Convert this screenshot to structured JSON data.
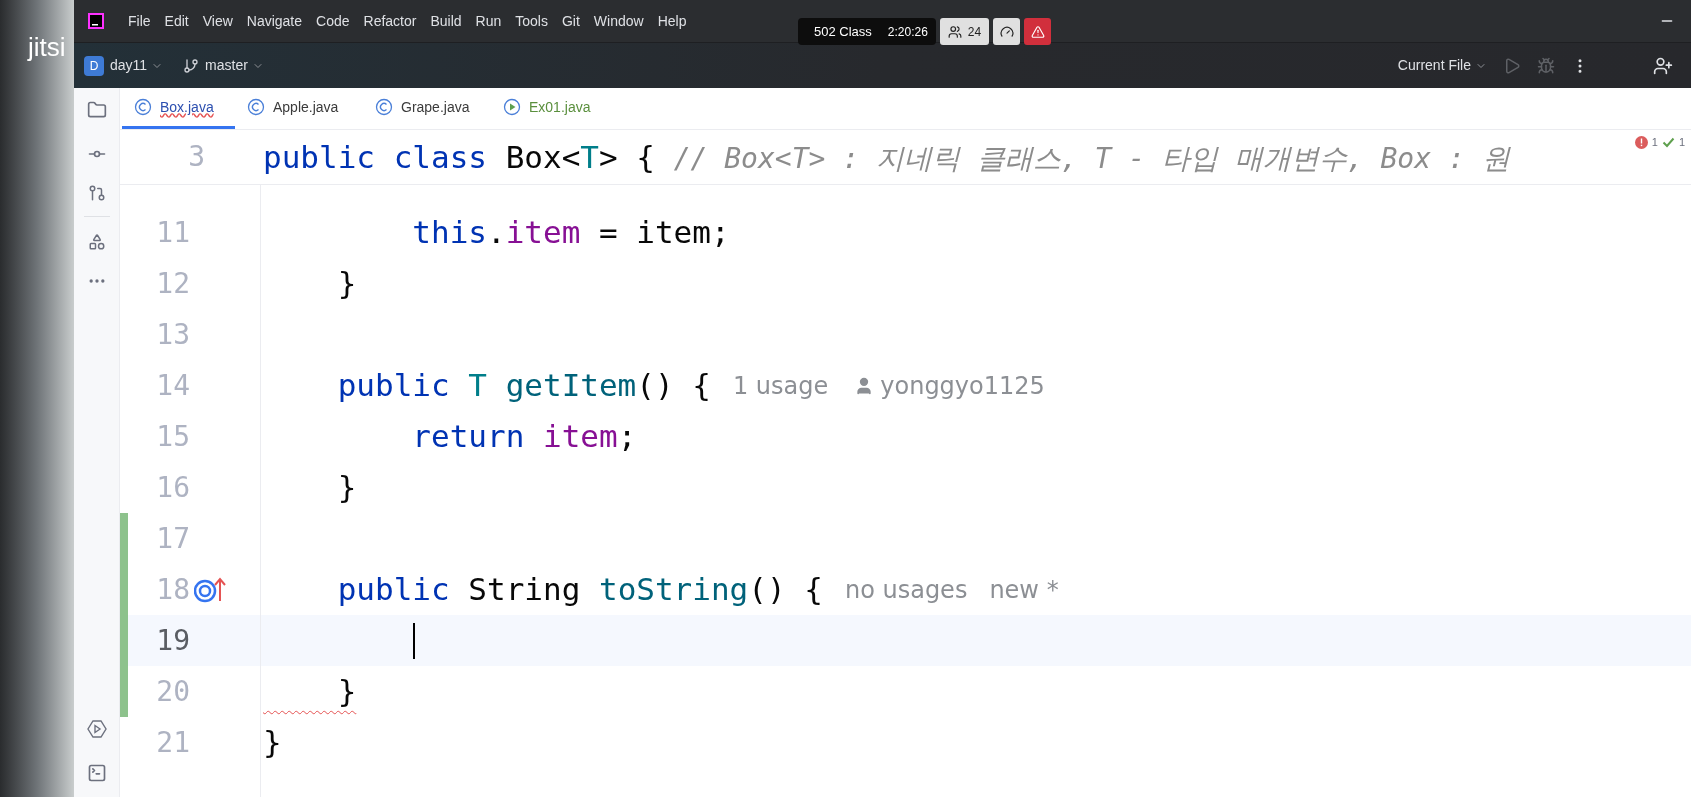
{
  "overlay": {
    "logo": "jitsi",
    "room": "502 Class",
    "timer": "2:20:26",
    "participants": "24"
  },
  "menu": [
    "File",
    "Edit",
    "View",
    "Navigate",
    "Code",
    "Refactor",
    "Build",
    "Run",
    "Tools",
    "Git",
    "Window",
    "Help"
  ],
  "toolbar": {
    "project_badge": "D",
    "project": "day11",
    "branch": "master",
    "run_config": "Current File"
  },
  "tabs": [
    {
      "label": "Box.java",
      "selected": true,
      "error": true,
      "added": false,
      "kind": "class"
    },
    {
      "label": "Apple.java",
      "selected": false,
      "error": false,
      "added": false,
      "kind": "class"
    },
    {
      "label": "Grape.java",
      "selected": false,
      "error": false,
      "added": false,
      "kind": "class"
    },
    {
      "label": "Ex01.java",
      "selected": false,
      "error": false,
      "added": true,
      "kind": "runnable"
    }
  ],
  "inspections": {
    "errors": "1",
    "warnings": "1"
  },
  "sticky_line": {
    "number": "3",
    "tokens": [
      {
        "kind": "keyword",
        "text": "public class "
      },
      {
        "kind": "plain",
        "text": "Box<"
      },
      {
        "kind": "typeparam",
        "text": "T"
      },
      {
        "kind": "plain",
        "text": "> { "
      },
      {
        "kind": "comment",
        "text": "// Box<T> : 지네릭 클래스, T - 타입 매개변수, Box : 원"
      }
    ]
  },
  "lines": [
    {
      "number": "11",
      "current": false,
      "changed": false,
      "error": false,
      "overrides": false,
      "tokens": [
        {
          "kind": "keyword",
          "text": "        this"
        },
        {
          "kind": "plain",
          "text": "."
        },
        {
          "kind": "field",
          "text": "item"
        },
        {
          "kind": "plain",
          "text": " = item;"
        }
      ]
    },
    {
      "number": "12",
      "current": false,
      "changed": false,
      "error": false,
      "overrides": false,
      "tokens": [
        {
          "kind": "plain",
          "text": "    }"
        }
      ]
    },
    {
      "number": "13",
      "current": false,
      "changed": false,
      "overrides": false
    },
    {
      "number": "14",
      "current": false,
      "changed": false,
      "error": false,
      "overrides": false,
      "tokens": [
        {
          "kind": "keyword",
          "text": "    public "
        },
        {
          "kind": "typeparam",
          "text": "T "
        },
        {
          "kind": "method",
          "text": "getItem"
        },
        {
          "kind": "plain",
          "text": "() {"
        }
      ],
      "hints": [
        {
          "kind": "usage",
          "text": "1 usage"
        },
        {
          "kind": "author",
          "text": "yonggyo1125"
        }
      ]
    },
    {
      "number": "15",
      "current": false,
      "changed": false,
      "error": false,
      "overrides": false,
      "tokens": [
        {
          "kind": "keyword",
          "text": "        return "
        },
        {
          "kind": "field",
          "text": "item"
        },
        {
          "kind": "plain",
          "text": ";"
        }
      ]
    },
    {
      "number": "16",
      "current": false,
      "changed": false,
      "error": false,
      "overrides": false,
      "tokens": [
        {
          "kind": "plain",
          "text": "    }"
        }
      ]
    },
    {
      "number": "17",
      "current": false,
      "changed": true,
      "overrides": false
    },
    {
      "number": "18",
      "current": false,
      "changed": true,
      "error": false,
      "overrides": true,
      "tokens": [
        {
          "kind": "keyword",
          "text": "    public "
        },
        {
          "kind": "plain",
          "text": "String "
        },
        {
          "kind": "method",
          "text": "toString"
        },
        {
          "kind": "plain",
          "text": "() {"
        }
      ],
      "hints": [
        {
          "kind": "usage",
          "text": "no usages"
        },
        {
          "kind": "usage",
          "text": "new *"
        }
      ]
    },
    {
      "number": "19",
      "current": true,
      "changed": true,
      "overrides": false
    },
    {
      "number": "20",
      "current": false,
      "changed": true,
      "error": true,
      "overrides": false,
      "tokens": [
        {
          "kind": "plain",
          "text": "    }"
        }
      ]
    },
    {
      "number": "21",
      "current": false,
      "changed": false,
      "error": false,
      "overrides": false,
      "tokens": [
        {
          "kind": "plain",
          "text": "}"
        }
      ]
    }
  ]
}
